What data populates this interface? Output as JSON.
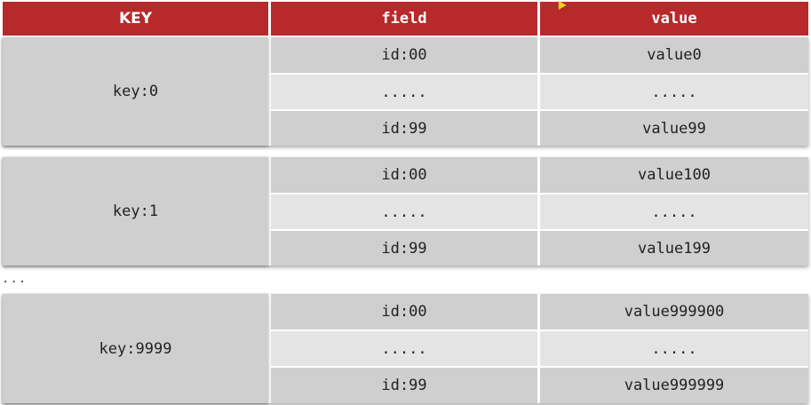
{
  "headers": {
    "key": "KEY",
    "field": "field",
    "value": "value"
  },
  "groups": [
    {
      "key": "key:0",
      "rows": [
        {
          "field": "id:00",
          "value": "value0"
        },
        {
          "field": ".....",
          "value": "....."
        },
        {
          "field": "id:99",
          "value": "value99"
        }
      ]
    },
    {
      "key": "key:1",
      "rows": [
        {
          "field": "id:00",
          "value": "value100"
        },
        {
          "field": ".....",
          "value": "....."
        },
        {
          "field": "id:99",
          "value": "value199"
        }
      ]
    },
    {
      "key": "key:9999",
      "rows": [
        {
          "field": "id:00",
          "value": "value999900"
        },
        {
          "field": ".....",
          "value": "....."
        },
        {
          "field": "id:99",
          "value": "value999999"
        }
      ]
    }
  ],
  "gap_ellipsis": "...",
  "colors": {
    "header_bg": "#b7292b",
    "header_text": "#ffffff",
    "cell_dark": "#cfcfcf",
    "cell_light": "#e4e4e4"
  },
  "icons": {
    "cursor": "mouse-cursor-icon"
  }
}
